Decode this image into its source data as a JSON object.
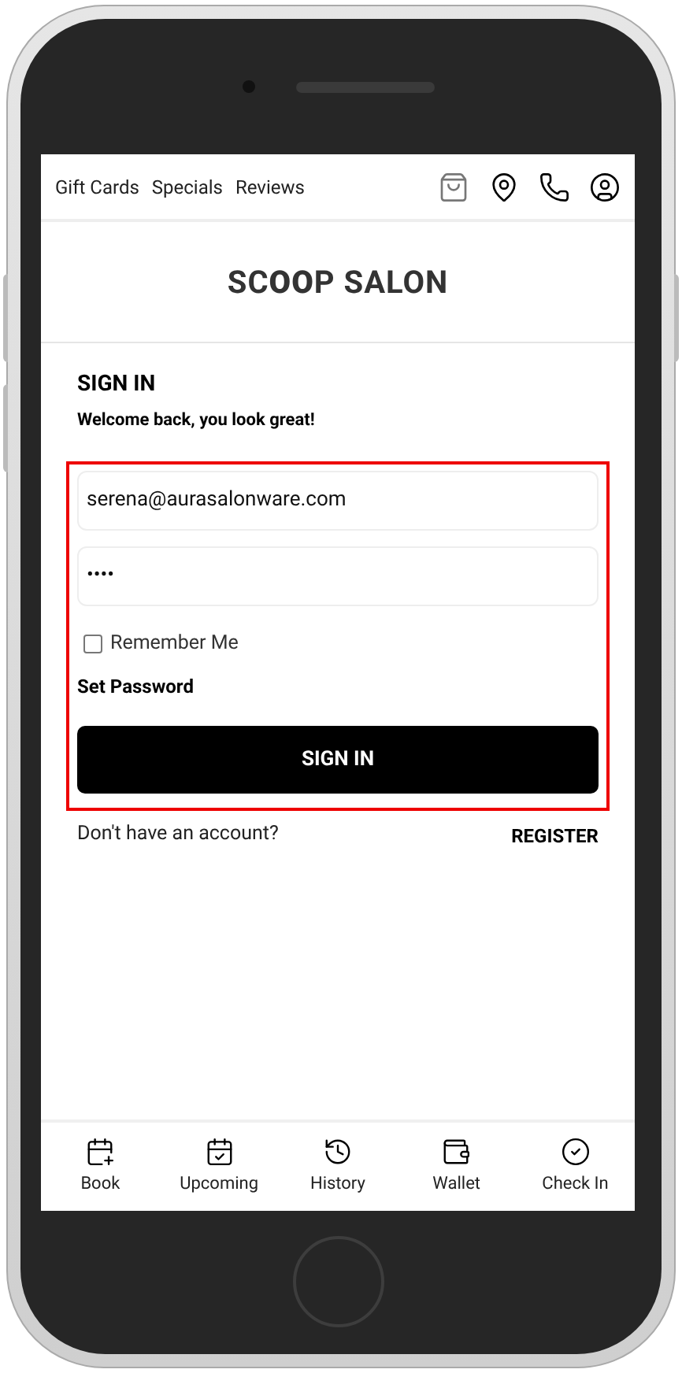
{
  "header": {
    "links": [
      {
        "label": "Gift Cards"
      },
      {
        "label": "Specials"
      },
      {
        "label": "Reviews"
      }
    ],
    "icons": [
      {
        "kind": "bag"
      },
      {
        "kind": "location"
      },
      {
        "kind": "phone"
      },
      {
        "kind": "account"
      }
    ]
  },
  "logo": "SC**OO**P SALON",
  "signin": {
    "title": "SIGN IN",
    "subtitle": "Welcome back, you look great!",
    "email": {
      "value": "serena@aurasalonware.com"
    },
    "password": {
      "value": "••••"
    },
    "remember": {
      "label": "Remember Me",
      "checked": false
    },
    "set_password": "Set Password",
    "button": "SIGN IN",
    "no_account": "Don't have an account?",
    "register": "REGISTER"
  },
  "bottom_nav": [
    {
      "kind": "book",
      "label": "Book"
    },
    {
      "kind": "upcoming",
      "label": "Upcoming"
    },
    {
      "kind": "history",
      "label": "History"
    },
    {
      "kind": "wallet",
      "label": "Wallet"
    },
    {
      "kind": "checkin",
      "label": "Check In"
    }
  ]
}
